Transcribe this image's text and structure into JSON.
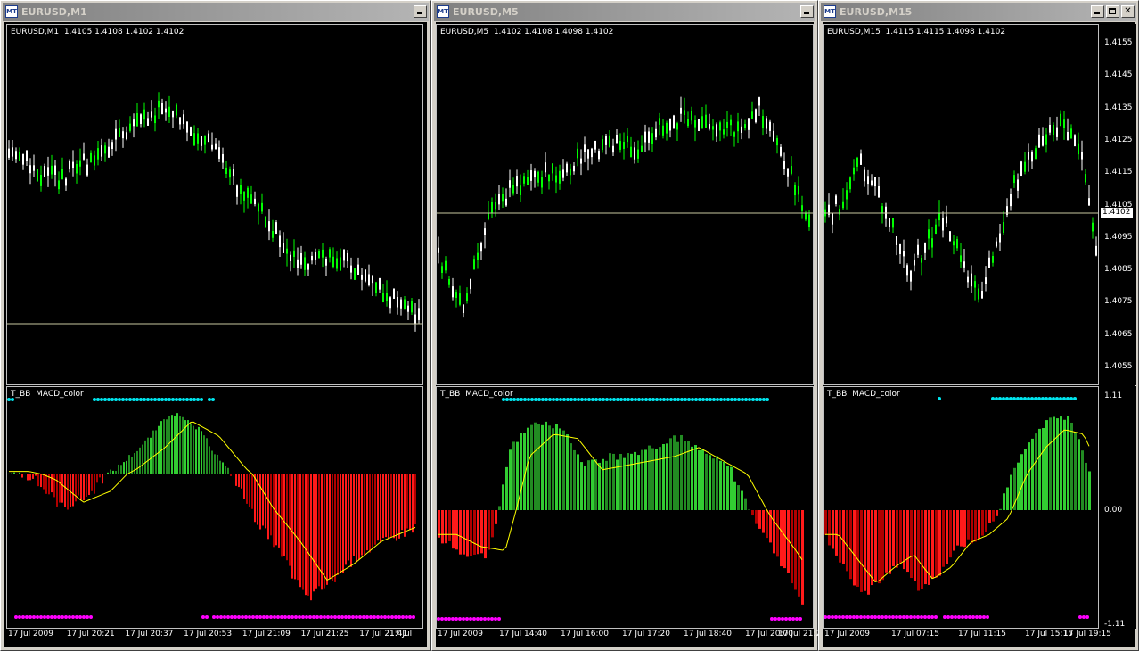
{
  "colors": {
    "bull_candle": "#00ff00",
    "bear_candle": "#ffffff",
    "bars_green": "#32cd32",
    "bars_green_dark": "#228b22",
    "bars_red": "#ff1a1a",
    "bars_red_dark": "#b00000",
    "signal": "#ffff00",
    "dot_cyan": "#00e5ee",
    "dot_magenta": "#ff00ff",
    "grid_line": "#c8c8a0"
  },
  "windows": [
    {
      "title": "EURUSD,M1",
      "header": "EURUSD,M1  1.4105 1.4108 1.4102 1.4102",
      "indicator_label": "T_BB  MACD_color",
      "buttons": [
        "minimize"
      ],
      "price_axis": [],
      "macd_axis": [],
      "time_labels": [
        "17 Jul 2009",
        "17 Jul 20:21",
        "17 Jul 20:37",
        "17 Jul 20:53",
        "17 Jul 21:09",
        "17 Jul 21:25",
        "17 Jul 21:41",
        "17 Jul"
      ],
      "current_price": null
    },
    {
      "title": "EURUSD,M5",
      "header": "EURUSD,M5  1.4102 1.4108 1.4098 1.4102",
      "indicator_label": "T_BB  MACD_color",
      "buttons": [
        "minimize"
      ],
      "price_axis": [],
      "macd_axis": [],
      "time_labels": [
        "17 Jul 2009",
        "17 Jul 14:40",
        "17 Jul 16:00",
        "17 Jul 17:20",
        "17 Jul 18:40",
        "17 Jul 20:00",
        "17 Jul 21:2"
      ],
      "current_price": null
    },
    {
      "title": "EURUSD,M15",
      "header": "EURUSD,M15  1.4115 1.4115 1.4098 1.4102",
      "indicator_label": "T_BB  MACD_color",
      "buttons": [
        "minimize",
        "maximize",
        "close"
      ],
      "price_axis": [
        "1.4155",
        "1.4145",
        "1.4135",
        "1.4125",
        "1.4115",
        "1.4105",
        "1.4095",
        "1.4085",
        "1.4075",
        "1.4065",
        "1.4055"
      ],
      "macd_axis": [
        "1.11",
        "0.00",
        "-1.11"
      ],
      "time_labels": [
        "17 Jul 2009",
        "17 Jul 07:15",
        "17 Jul 11:15",
        "17 Jul 15:15",
        "17 Jul 19:15"
      ],
      "current_price": "1.4102"
    }
  ]
}
